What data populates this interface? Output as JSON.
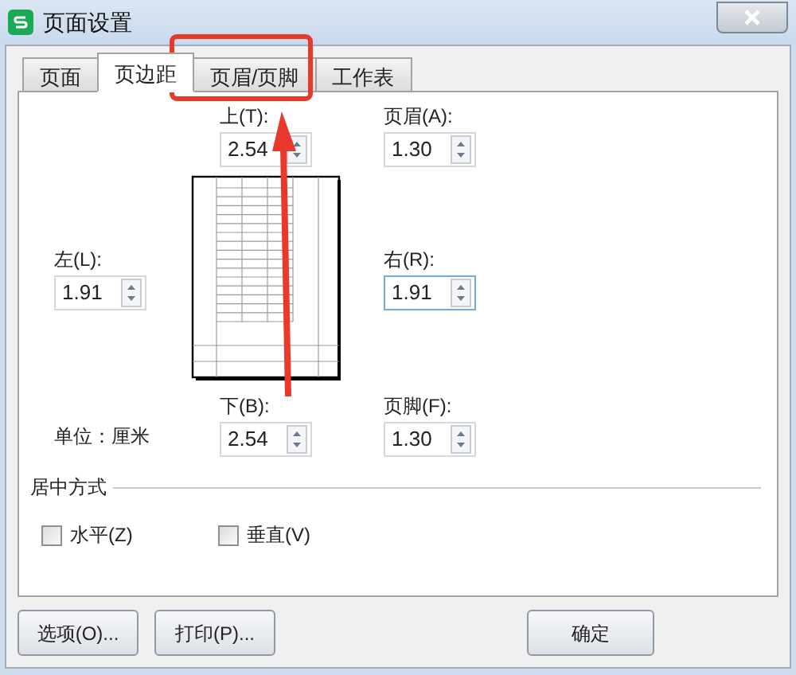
{
  "window": {
    "title": "页面设置"
  },
  "tabs": [
    {
      "label": "页面",
      "selected": false
    },
    {
      "label": "页边距",
      "selected": true
    },
    {
      "label": "页眉/页脚",
      "selected": false
    },
    {
      "label": "工作表",
      "selected": false
    }
  ],
  "margins": {
    "top": {
      "label": "上(T):",
      "value": "2.54",
      "focused": false
    },
    "header": {
      "label": "页眉(A):",
      "value": "1.30",
      "focused": false
    },
    "left": {
      "label": "左(L):",
      "value": "1.91",
      "focused": false
    },
    "right": {
      "label": "右(R):",
      "value": "1.91",
      "focused": true
    },
    "bottom": {
      "label": "下(B):",
      "value": "2.54",
      "focused": false
    },
    "footer": {
      "label": "页脚(F):",
      "value": "1.30",
      "focused": false
    },
    "unit": "单位：厘米"
  },
  "center_on_page": {
    "title": "居中方式",
    "options": [
      {
        "label": "水平(Z)",
        "checked": false
      },
      {
        "label": "垂直(V)",
        "checked": false
      }
    ]
  },
  "buttons_left": [
    "选项(O)...",
    "打印(P)..."
  ],
  "buttons_right": [
    "确定"
  ]
}
